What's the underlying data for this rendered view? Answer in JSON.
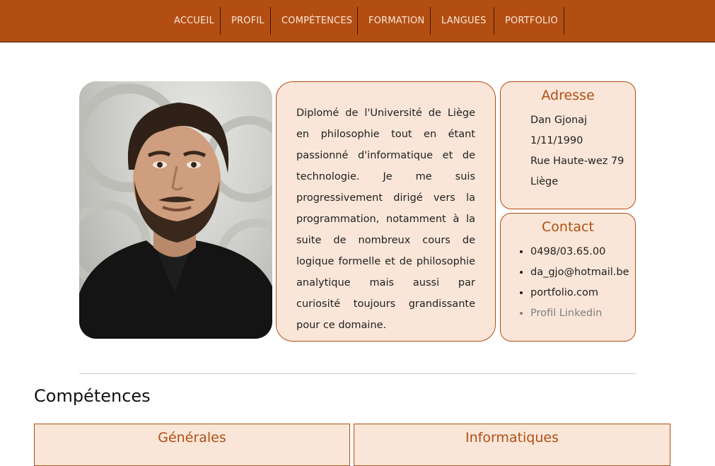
{
  "nav": {
    "items": [
      "ACCUEIL",
      "PROFIL",
      "COMPÉTENCES",
      "FORMATION",
      "LANGUES",
      "PORTFOLIO"
    ]
  },
  "bio": {
    "text": "Diplomé de l'Université de Liège en philosophie tout en étant passionné d'informatique et de technologie. Je me suis progressivement dirigé vers la programmation, notamment à la suite de nombreux cours de logique formelle et de philosophie analytique mais aussi par curiosité toujours grandissante pour ce domaine."
  },
  "address": {
    "title": "Adresse",
    "lines": [
      "Dan Gjonaj",
      "1/11/1990",
      "Rue Haute-wez 79",
      "Liège"
    ]
  },
  "contact": {
    "title": "Contact",
    "items": [
      "0498/03.65.00",
      "da_gjo@hotmail.be",
      "portfolio.com",
      "Profil Linkedin"
    ]
  },
  "skills": {
    "title": "Compétences",
    "general_title": "Générales",
    "it_title": "Informatiques"
  },
  "colors": {
    "brand": "#b24e12",
    "card_bg": "#f9e6d8"
  }
}
